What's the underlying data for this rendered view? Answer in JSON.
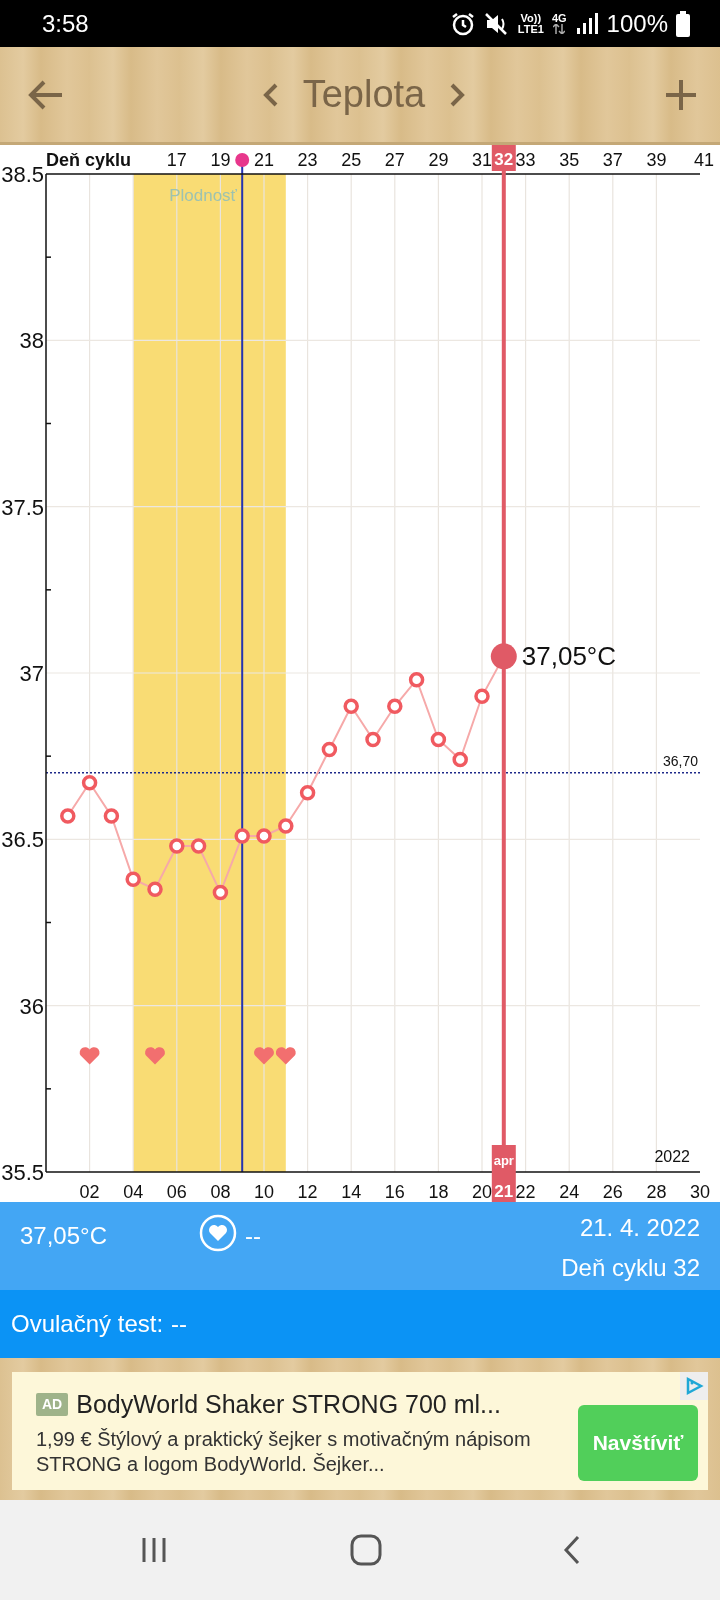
{
  "status_bar": {
    "time": "3:58",
    "network_labels": [
      "Vo))",
      "LTE1",
      "4G"
    ],
    "battery": "100%"
  },
  "header": {
    "title": "Teplota"
  },
  "chart": {
    "chart_data": {
      "type": "line",
      "x": [
        1,
        2,
        3,
        4,
        5,
        6,
        7,
        8,
        9,
        10,
        11,
        12,
        13,
        14,
        15,
        16,
        17,
        18,
        19,
        20,
        21
      ],
      "grid": true,
      "series": [
        {
          "color": "#f05a60",
          "marker": "circle",
          "values": [
            36.57,
            36.67,
            36.57,
            36.38,
            36.35,
            36.48,
            36.48,
            36.34,
            36.51,
            36.51,
            36.54,
            36.64,
            36.77,
            36.9,
            36.8,
            36.9,
            36.98,
            36.8,
            36.74,
            36.93,
            37.05
          ]
        },
        {
          "type": "scatter",
          "color": "#f26f6f",
          "values": [
            null,
            35.85,
            null,
            null,
            35.85,
            null,
            null,
            null,
            null,
            35.85,
            35.85,
            null,
            null,
            null,
            null,
            null,
            null,
            null,
            null,
            null,
            null
          ]
        }
      ],
      "xlim": [
        0,
        30
      ],
      "ylim": [
        35.5,
        38.5
      ],
      "xticks": [
        {
          "value": 2,
          "label": "02"
        },
        {
          "value": 4,
          "label": "04"
        },
        {
          "value": 6,
          "label": "06"
        },
        {
          "value": 8,
          "label": "08"
        },
        {
          "value": 10,
          "label": "10"
        },
        {
          "value": 12,
          "label": "12"
        },
        {
          "value": 14,
          "label": "14"
        },
        {
          "value": 16,
          "label": "16"
        },
        {
          "value": 18,
          "label": "18"
        },
        {
          "value": 20,
          "label": "20"
        },
        {
          "value": 22,
          "label": "22"
        },
        {
          "value": 24,
          "label": "24"
        },
        {
          "value": 26,
          "label": "26"
        },
        {
          "value": 28,
          "label": "28"
        },
        {
          "value": 30,
          "label": "30"
        }
      ],
      "yticks": [
        {
          "value": 35.5,
          "label": "35.5"
        },
        {
          "value": 36,
          "label": "36"
        },
        {
          "value": 36.5,
          "label": "36.5"
        },
        {
          "value": 37,
          "label": "37"
        },
        {
          "value": 37.5,
          "label": "37.5"
        },
        {
          "value": 38,
          "label": "38"
        },
        {
          "value": 38.5,
          "label": "38.5"
        }
      ],
      "bands": [
        {
          "axis": "x",
          "from": 4,
          "to": 11,
          "label": "Plodnosť",
          "color": "#f9dc74"
        }
      ],
      "ref_lines": [
        {
          "axis": "x",
          "value": 9,
          "color": "#2533b0"
        },
        {
          "axis": "x",
          "value": 21,
          "color": "#e05a66"
        },
        {
          "axis": "y",
          "value": 36.7,
          "label": "36,70",
          "color": "#1f2a8a"
        }
      ]
    },
    "cycle_axis": {
      "title": "Deň cyklu",
      "ticks": [
        "17",
        "19",
        "21",
        "23",
        "25",
        "27",
        "29",
        "31",
        "33",
        "35",
        "37",
        "39",
        "41"
      ]
    },
    "cursor": {
      "top_label": "32",
      "bottom_label": "apr",
      "bottom_sublabel": "21",
      "value_label": "37,05°C"
    },
    "year_label": "2022"
  },
  "summary": {
    "temperature": "37,05°C",
    "intercourse": "--",
    "date": "21. 4. 2022",
    "cycle_day": "Deň cyklu 32"
  },
  "ovulation_test": {
    "label": "Ovulačný test:",
    "value": "--"
  },
  "ad": {
    "badge": "AD",
    "title": "BodyWorld Shaker STRONG 700 ml...",
    "text": "1,99 € Štýlový a praktický šejker s motivačným nápisom STRONG a logom BodyWorld. Šejker...",
    "button": "Navštíviť"
  }
}
